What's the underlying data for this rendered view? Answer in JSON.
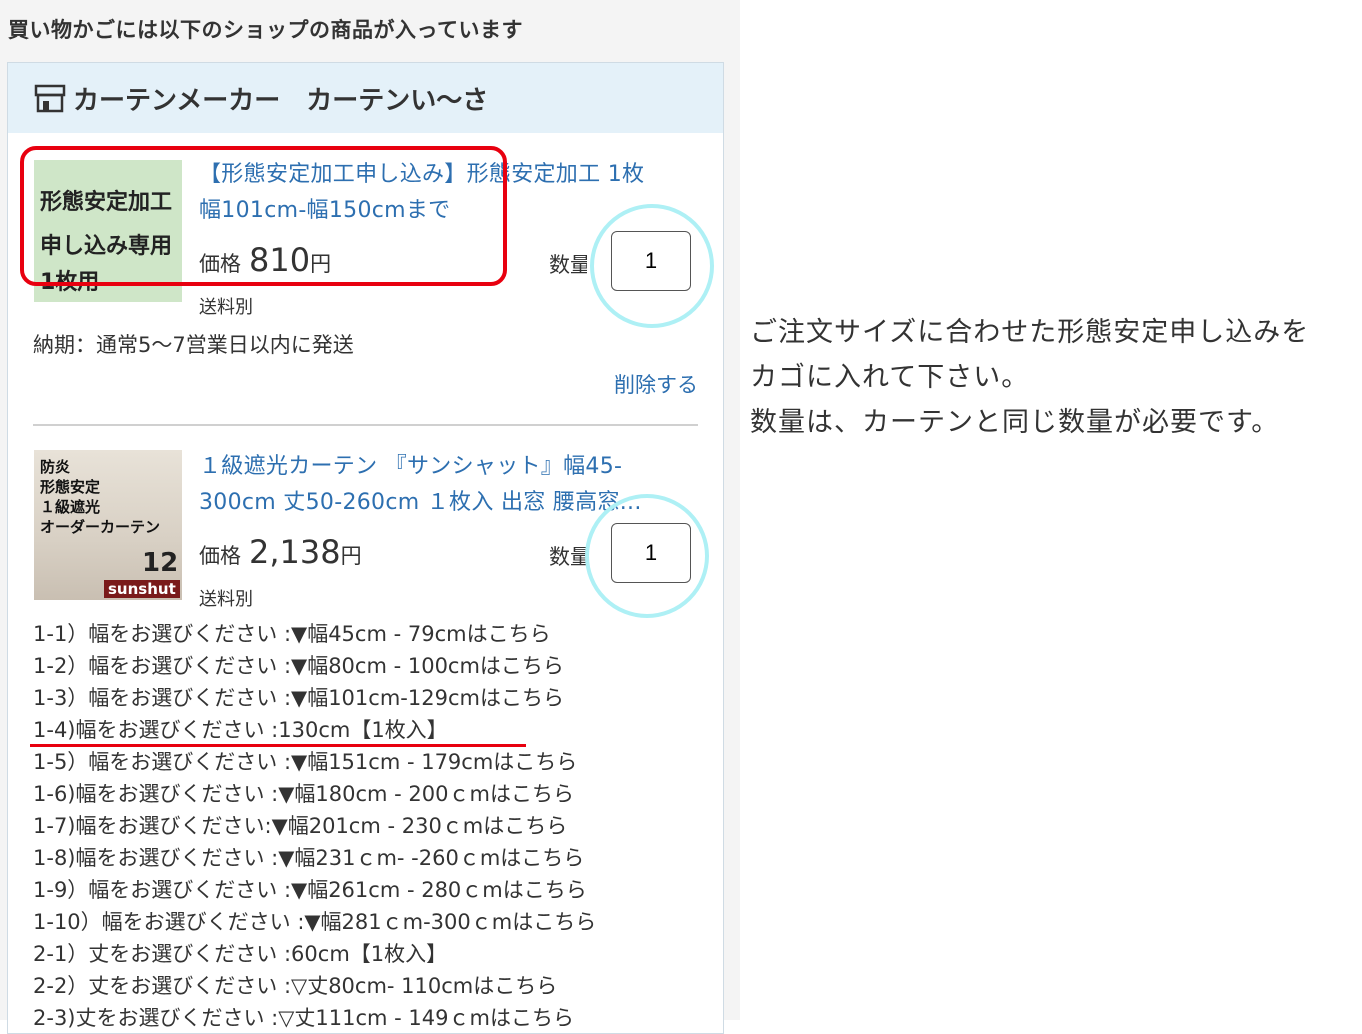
{
  "cart": {
    "heading": "買い物かごには以下のショップの商品が入っています",
    "shop": {
      "icon": "store-icon",
      "name": "カーテンメーカー　カーテンい〜さ"
    },
    "items": [
      {
        "thumb_lines": [
          "形態安定加工",
          "申し込み専用",
          "1枚用"
        ],
        "title": "【形態安定加工申し込み】形態安定加工 1枚 幅101cm-幅150cmまで",
        "price_label": "価格",
        "price_value": "810",
        "price_unit": "円",
        "shipping": "送料別",
        "qty_label": "数量",
        "qty": "1",
        "delivery": "納期：通常5〜7営業日以内に発送",
        "delete": "削除する"
      },
      {
        "thumb_lines": [
          "防炎",
          "形態安定",
          "１級遮光",
          "オーダーカーテン"
        ],
        "thumb_badge": "12",
        "thumb_brand": "sunshut",
        "title": "１級遮光カーテン 『サンシャット』幅45-300cm 丈50-260cm １枚入 出窓 腰高窓...",
        "price_label": "価格",
        "price_value": "2,138",
        "price_unit": "円",
        "shipping": "送料別",
        "qty_label": "数量",
        "qty": "1",
        "options": [
          "1-1）幅をお選びください :▼幅45cm - 79cmはこちら",
          "1-2）幅をお選びください :▼幅80cm - 100cmはこちら",
          "1-3）幅をお選びください :▼幅101cm-129cmはこちら",
          "1-4)幅をお選びください :130cm【1枚入】",
          "1-5）幅をお選びください :▼幅151cm - 179cmはこちら",
          "1-6)幅をお選びください :▼幅180cm - 200ｃmはこちら",
          "1-7)幅をお選びください:▼幅201cm - 230ｃmはこちら",
          "1-8)幅をお選びください :▼幅231ｃm- -260ｃmはこちら",
          "1-9）幅をお選びください :▼幅261cm - 280ｃmはこちら",
          "1-10）幅をお選びください :▼幅281ｃm-300ｃmはこちら",
          "2-1）丈をお選びください :60cm【1枚入】",
          "2-2）丈をお選びください :▽丈80cm- 110cmはこちら",
          "2-3)丈をお選びください :▽丈111cm - 149ｃmはこちら"
        ]
      }
    ]
  },
  "annotation": {
    "note_lines": [
      "ご注文サイズに合わせた形態安定申し込みを",
      "カゴに入れて下さい。",
      "数量は、カーテンと同じ数量が必要です。"
    ],
    "highlight_color": "#e8000f",
    "circle_color": "#aef0f5"
  }
}
